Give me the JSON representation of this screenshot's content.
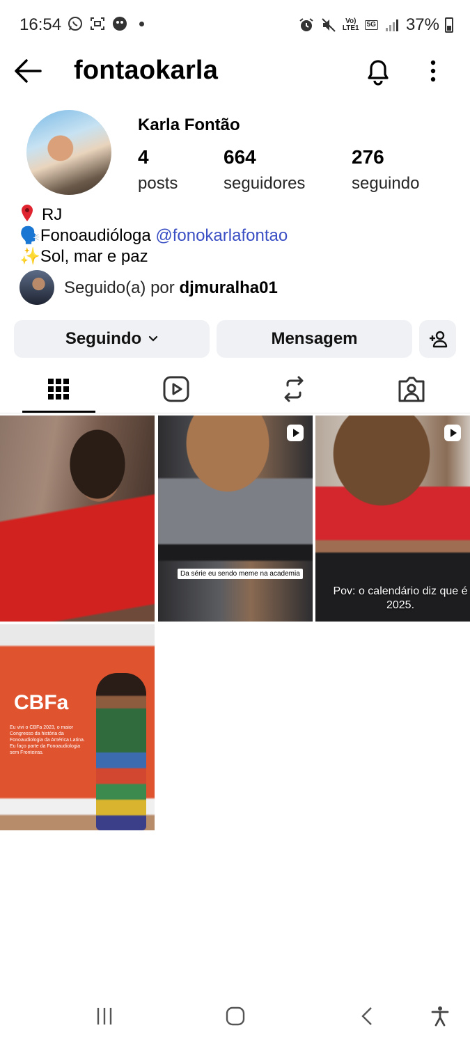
{
  "status_bar": {
    "time": "16:54",
    "network_top": "Vo)",
    "network_bottom": "LTE1",
    "network_type": "5G",
    "battery": "37%"
  },
  "header": {
    "username": "fontaokarla",
    "icons": [
      "back-arrow-icon",
      "bell-icon",
      "more-vertical-icon"
    ]
  },
  "profile": {
    "display_name": "Karla Fontão",
    "stats": [
      {
        "value": "4",
        "label": "posts"
      },
      {
        "value": "664",
        "label": "seguidores"
      },
      {
        "value": "276",
        "label": "seguindo"
      }
    ],
    "bio": {
      "location": "RJ",
      "profession_prefix": "🗣️Fonoaudióloga ",
      "mention": "@fonokarlafontao",
      "motto": "✨Sol, mar e paz"
    },
    "followed_by_prefix": "Seguido(a) por ",
    "followed_by_user": "djmuralha01"
  },
  "actions": {
    "following_label": "Seguindo",
    "message_label": "Mensagem"
  },
  "tabs": [
    "grid-icon",
    "reels-icon",
    "reposts-icon",
    "tagged-icon"
  ],
  "posts": {
    "p2_caption": "Da série eu sendo meme na academia",
    "p3_caption": "Pov: o calendário diz que é 2025.",
    "p4_logo": "CBFa",
    "p4_text": "Eu vivi o CBFa 2023, o maior Congresso da história da Fonoaudiologia da América Latina. Eu faço parte da Fonoaudiologia sem Fronteiras."
  },
  "colors": {
    "accent_link": "#3b4fc4",
    "button_bg": "#eff1f4"
  }
}
